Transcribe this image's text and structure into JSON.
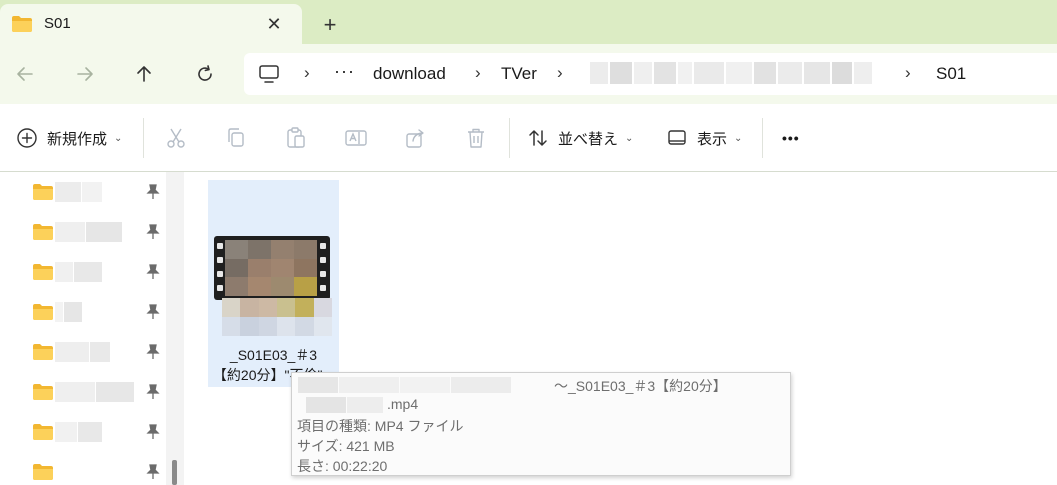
{
  "window": {
    "tab_title": "S01",
    "tab_icon": "folder-icon",
    "accent_color": "#dcecc4"
  },
  "nav": {
    "back_icon": "arrow-left-icon",
    "forward_icon": "arrow-right-icon",
    "up_icon": "arrow-up-icon",
    "refresh_icon": "refresh-icon"
  },
  "address": {
    "pc_icon": "monitor-icon",
    "ellipsis": "···",
    "crumbs": [
      "download",
      "TVer",
      "S01"
    ]
  },
  "commandbar": {
    "new_label": "新規作成",
    "sort_label": "並べ替え",
    "view_label": "表示",
    "more_label": "•••",
    "icons": [
      "cut-icon",
      "copy-icon",
      "paste-icon",
      "rename-icon",
      "share-icon",
      "delete-icon"
    ]
  },
  "navpane": {
    "items_count_label": "",
    "pin_icon": "pin-icon"
  },
  "file": {
    "name_line1": "_S01E03_＃3",
    "name_line2": "【約20分】\"不倫\"..."
  },
  "tooltip": {
    "title_tail": "〜_S01E03_＃3【約20分】",
    "filename_tail": ".mp4",
    "type": "項目の種類: MP4 ファイル",
    "size": "サイズ: 421 MB",
    "length": "長さ: 00:22:20"
  }
}
